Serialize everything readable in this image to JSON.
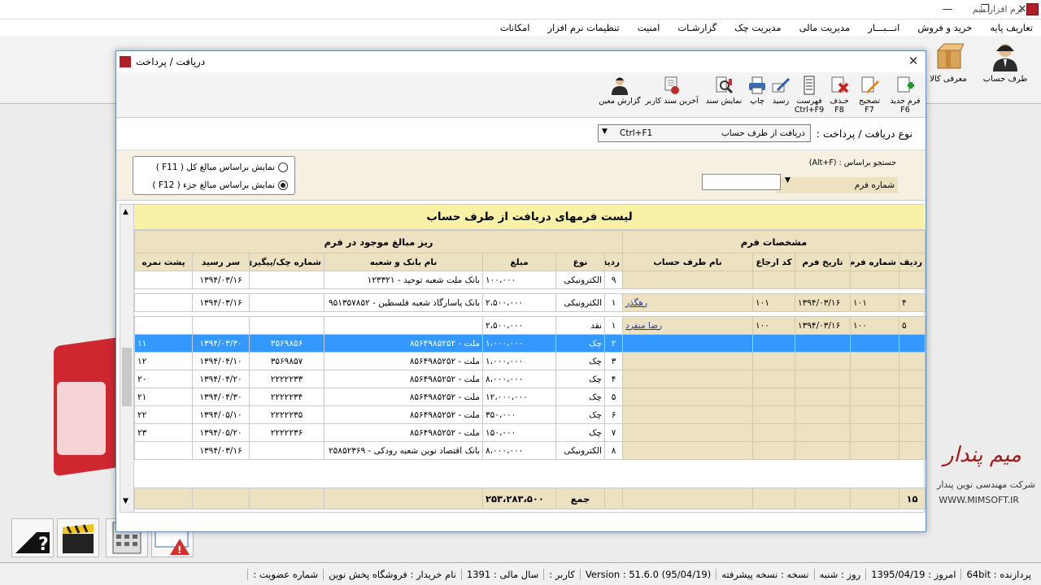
{
  "app": {
    "title": "نرم افزار میم"
  },
  "window_buttons": {
    "minimize": "—",
    "maximize": "❐",
    "close": "✕"
  },
  "menu": [
    "تعاریف پایه",
    "خرید و فروش",
    "انـــبـــار",
    "مدیریت مالی",
    "مدیریت چک",
    "گزارشـات",
    "امنیت",
    "تنظیمات نرم افزار",
    "امکانات"
  ],
  "main_toolbar": {
    "account_party": "طرف حساب",
    "goods_intro": "معرفی کالا"
  },
  "dialog": {
    "title": "دریافت / پرداخت",
    "close": "✕",
    "toolbar": [
      {
        "label": "فرم جدید",
        "key": "F6",
        "icon": "new-form-icon"
      },
      {
        "label": "تصحیح",
        "key": "F7",
        "icon": "edit-icon"
      },
      {
        "label": "حـذف",
        "key": "F8",
        "icon": "delete-icon"
      },
      {
        "label": "فهرست",
        "key": "Ctrl+F9",
        "icon": "list-icon"
      },
      {
        "label": "رسید",
        "key": "",
        "icon": "receipt-icon"
      },
      {
        "label": "چاپ",
        "key": "",
        "icon": "print-icon"
      },
      {
        "label": "نمایش سند",
        "key": "",
        "icon": "view-document-icon"
      },
      {
        "label": "آخرین سند کاربر",
        "key": "",
        "icon": "last-user-document-icon"
      },
      {
        "label": "گزارش معین",
        "key": "",
        "icon": "ledger-report-icon"
      }
    ],
    "type_label": "نوع دریافت / پرداخت :",
    "type_value": "دریافت از طرف حساب",
    "type_shortcut": "Ctrl+F1",
    "search_label": "جستجو براساس : (Alt+F)",
    "search_field_label": "شماره فرم",
    "radios": [
      {
        "label": "نمایش براساس مبالغ کل ( F11 )",
        "selected": false
      },
      {
        "label": "نمایش براساس مبالغ جزء ( F12 )",
        "selected": true
      }
    ],
    "grid": {
      "title": "لیست فرمهای دریافت از طرف حساب",
      "group_form": "مشخصات فرم",
      "group_details": "ریز مبالغ موجود در فرم",
      "columns": [
        "ردیف",
        "شماره فرم",
        "تاریخ فرم",
        "کد ارجاع",
        "نام طرف حساب",
        "ردیف",
        "نوع",
        "مبلغ",
        "نام بانک و شعبه",
        "شماره چک/پیگیری",
        "سر رسید",
        "پشت نمره"
      ],
      "rows": [
        {
          "row": "",
          "form_no": "",
          "date": "",
          "ref": "",
          "party": "",
          "sub": "۹",
          "type": "الکترونیکی",
          "amount": "۱۰۰،۰۰۰",
          "bank": "بانک ملت شعبه توحید - ۱۲۳۳۲۱",
          "cheque": "",
          "due": "۱۳۹۴/۰۳/۱۶",
          "back": ""
        },
        {
          "row": "۴",
          "form_no": "۱۰۱",
          "date": "۱۳۹۴/۰۳/۱۶",
          "ref": "۱۰۱",
          "party": "رهگذر",
          "sub": "۱",
          "type": "الکترونیکی",
          "amount": "۲،۵۰۰،۰۰۰",
          "bank": "بانک پاسارگاد شعبه فلسطین - ۹۵۱۳۵۷۸۵۲",
          "cheque": "",
          "due": "۱۳۹۴/۰۳/۱۶",
          "back": ""
        },
        {
          "row": "۵",
          "form_no": "۱۰۰",
          "date": "۱۳۹۴/۰۳/۱۶",
          "ref": "۱۰۰",
          "party": "رضا منفرد",
          "sub": "۱",
          "type": "نقد",
          "amount": "۲،۵۰۰،۰۰۰",
          "bank": "",
          "cheque": "",
          "due": "",
          "back": ""
        },
        {
          "row": "",
          "form_no": "",
          "date": "",
          "ref": "",
          "party": "",
          "sub": "۲",
          "type": "چک",
          "amount": "۱،۰۰۰،۰۰۰",
          "bank": "ملت - ۸۵۶۴۹۸۵۲۵۲",
          "cheque": "۳۵۶۹۸۵۶",
          "due": "۱۳۹۴/۰۳/۳۰",
          "back": "۱۱"
        },
        {
          "row": "",
          "form_no": "",
          "date": "",
          "ref": "",
          "party": "",
          "sub": "۳",
          "type": "چک",
          "amount": "۱،۰۰۰،۰۰۰",
          "bank": "ملت - ۸۵۶۴۹۸۵۲۵۲",
          "cheque": "۳۵۶۹۸۵۷",
          "due": "۱۳۹۴/۰۴/۱۰",
          "back": "۱۲"
        },
        {
          "row": "",
          "form_no": "",
          "date": "",
          "ref": "",
          "party": "",
          "sub": "۴",
          "type": "چک",
          "amount": "۸،۰۰۰،۰۰۰",
          "bank": "ملت - ۸۵۶۴۹۸۵۲۵۲",
          "cheque": "۲۲۲۲۲۳۳",
          "due": "۱۳۹۴/۰۴/۲۰",
          "back": "۲۰"
        },
        {
          "row": "",
          "form_no": "",
          "date": "",
          "ref": "",
          "party": "",
          "sub": "۵",
          "type": "چک",
          "amount": "۱۲،۰۰۰،۰۰۰",
          "bank": "ملت - ۸۵۶۴۹۸۵۲۵۲",
          "cheque": "۲۲۲۲۲۳۴",
          "due": "۱۳۹۴/۰۴/۳۰",
          "back": "۲۱"
        },
        {
          "row": "",
          "form_no": "",
          "date": "",
          "ref": "",
          "party": "",
          "sub": "۶",
          "type": "چک",
          "amount": "۳۵۰،۰۰۰",
          "bank": "ملت - ۸۵۶۴۹۸۵۲۵۲",
          "cheque": "۲۲۲۲۲۳۵",
          "due": "۱۳۹۴/۰۵/۱۰",
          "back": "۲۲"
        },
        {
          "row": "",
          "form_no": "",
          "date": "",
          "ref": "",
          "party": "",
          "sub": "۷",
          "type": "چک",
          "amount": "۱۵۰،۰۰۰",
          "bank": "ملت - ۸۵۶۴۹۸۵۲۵۲",
          "cheque": "۲۲۲۲۲۳۶",
          "due": "۱۳۹۴/۰۵/۲۰",
          "back": "۲۳"
        },
        {
          "row": "",
          "form_no": "",
          "date": "",
          "ref": "",
          "party": "",
          "sub": "۸",
          "type": "الکترونیکی",
          "amount": "۸،۰۰۰،۰۰۰",
          "bank": "بانک اقتصاد نوین شعبه رودکی - ۲۵۸۵۲۳۶۹",
          "cheque": "",
          "due": "۱۳۹۴/۰۳/۱۶",
          "back": ""
        }
      ],
      "summary": {
        "count": "۱۵",
        "label": "جمع",
        "total": "۲۵۳،۲۸۳،۵۰۰"
      }
    }
  },
  "company": {
    "signature": "میم پندار",
    "name": "شرکت مهندسی نوین پندار",
    "website": "WWW.MIMSOFT.IR"
  },
  "status": [
    "پردازنده : 64bit",
    "امروز : 1395/04/19",
    "روز : شنبه",
    "نسخه : نسخه پیشرفته",
    "Version : 51.6.0 (95/04/19)",
    "کاربر :",
    "سال مالی : 1391",
    "نام خریدار : فروشگاه  پخش نوین",
    "شماره عضویت :"
  ]
}
